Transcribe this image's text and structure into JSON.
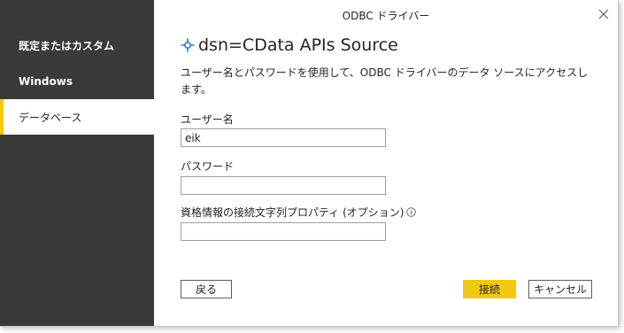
{
  "dialog": {
    "title": "ODBC ドライバー",
    "close_label": "×"
  },
  "sidebar": {
    "items": [
      {
        "label": "既定またはカスタム",
        "selected": false
      },
      {
        "label": "Windows",
        "selected": false
      },
      {
        "label": "データベース",
        "selected": true
      }
    ]
  },
  "main": {
    "heading": "dsn=CData APIs Source",
    "description": "ユーザー名とパスワードを使用して、ODBC ドライバーのデータ ソースにアクセスします。",
    "username": {
      "label": "ユーザー名",
      "value": "eik"
    },
    "password": {
      "label": "パスワード",
      "value": ""
    },
    "credential_props": {
      "label": "資格情報の接続文字列プロパティ (オプション)",
      "value": ""
    }
  },
  "buttons": {
    "back": "戻る",
    "connect": "接続",
    "cancel": "キャンセル"
  },
  "colors": {
    "sidebar_bg": "#3b3a39",
    "accent": "#f2c811"
  }
}
